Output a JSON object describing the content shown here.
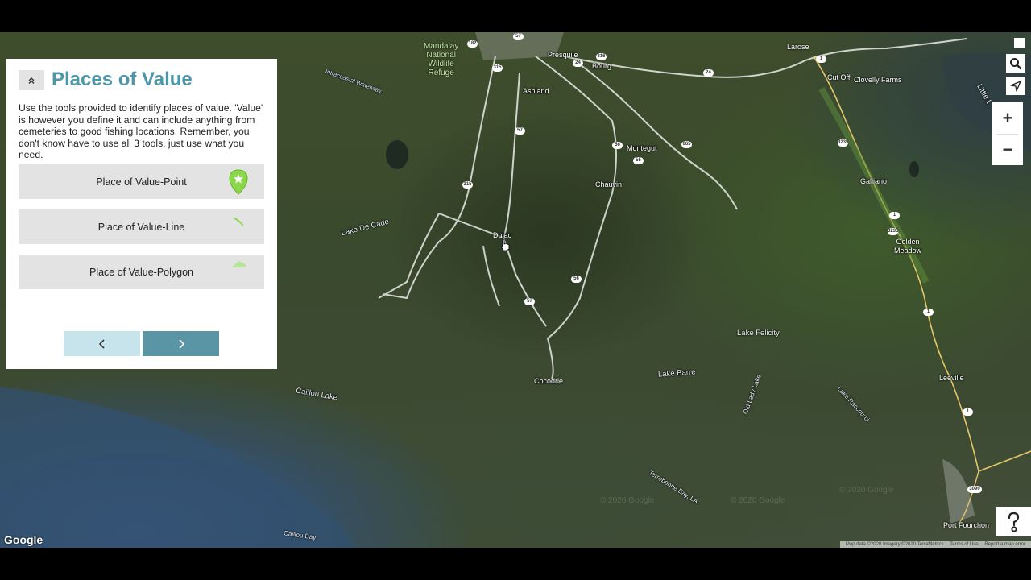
{
  "panel": {
    "title": "Places of Value",
    "description": "Use the tools provided to identify places of value. 'Value' is however you define it and can include anything from cemeteries to good fishing locations. Remember, you don't know have to use all 3 tools, just use what you need.",
    "tools": [
      {
        "label": "Place of Value-Point",
        "icon": "map-pin-icon",
        "color": "#8bd64a"
      },
      {
        "label": "Place of Value-Line",
        "icon": "line-draw-icon",
        "color": "#8bd64a"
      },
      {
        "label": "Place of Value-Polygon",
        "icon": "polygon-draw-icon",
        "color": "#b7e39a"
      }
    ],
    "prev_icon": "chevron-left-icon",
    "next_icon": "chevron-right-icon"
  },
  "map": {
    "places": {
      "mandalay": "Mandalay\nNational\nWildlife\nRefuge",
      "intracoastal": "Intracoastal Waterway",
      "presquile": "Presquile",
      "bourg": "Bourg",
      "ashland": "Ashland",
      "larose": "Larose",
      "cut_off": "Cut Off",
      "clovelly": "Clovelly Farms",
      "montegut": "Montegut",
      "chauvin": "Chauvin",
      "galliano": "Galliano",
      "golden_meadow": "Golden\nMeadow",
      "lake_de_cade": "Lake De Cade",
      "dulac": "Dulac",
      "lake_felicity": "Lake Felicity",
      "lake_barre": "Lake Barre",
      "cocodrie": "Cocodrie",
      "caillou_lake": "Caillou Lake",
      "old_lady_lake": "Old Lady Lake",
      "lake_raccourci": "Lake Raccourci",
      "leeville": "Leeville",
      "terrebonne_bay": "Terrebonne Bay, LA",
      "port_fourchon": "Port Fourchon",
      "caillou_bay": "Caillou Bay",
      "little_lake": "Little L"
    },
    "shields": [
      "182",
      "57",
      "24",
      "316",
      "315",
      "24",
      "1",
      "57",
      "56",
      "665",
      "55",
      "3235",
      "315",
      "1",
      "3235",
      "56",
      "57",
      "1",
      "1",
      "3090"
    ],
    "google_logo": "Google",
    "attribution": [
      "Map data ©2020 Imagery ©2020 TerraMetrics",
      "Terms of Use",
      "Report a map error"
    ],
    "watermark": "© 2020 Google"
  },
  "controls": {
    "zoom_in": "+",
    "zoom_out": "−",
    "search_icon": "search-icon",
    "locate_icon": "locate-arrow-icon",
    "help_icon": "help-icon"
  }
}
